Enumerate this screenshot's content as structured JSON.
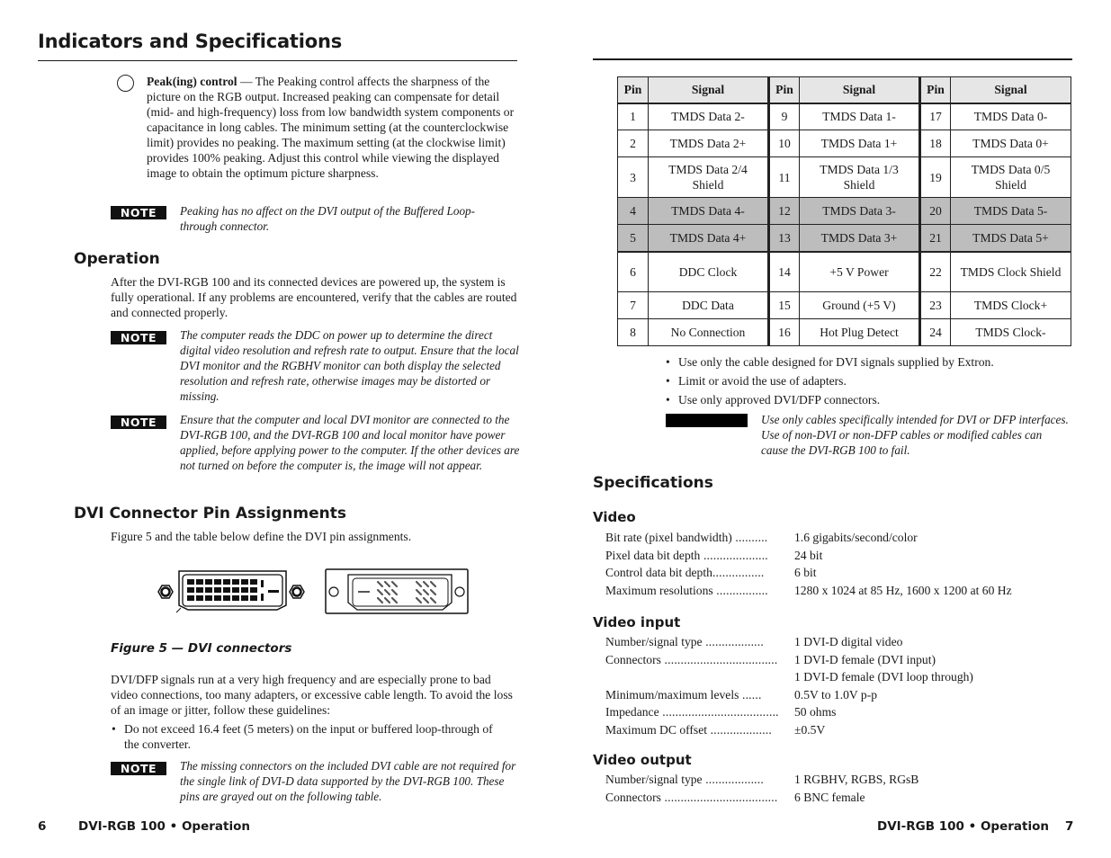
{
  "left_page": {
    "title": "Indicators and Specifications",
    "peak_control": {
      "icon": "circle-control-icon",
      "label": "Peak(ing) control",
      "text": " — The Peaking control affects the sharpness of the picture on the RGB output.  Increased peaking can compensate for detail (mid- and high-frequency) loss from low bandwidth system components or capacitance in long cables.  The minimum setting (at the counterclockwise limit) provides no peaking.  The maximum setting (at the clockwise limit) provides 100% peaking.  Adjust this control while viewing the displayed image to obtain the optimum picture sharpness."
    },
    "note_label": "NOTE",
    "note_peaking": "Peaking has no affect on the DVI output of the Buffered Loop-through connector.",
    "operation": {
      "heading": "Operation",
      "text": "After the DVI-RGB 100 and its connected devices are powered up, the system is fully operational.  If any problems are encountered, verify that the cables are routed and connected properly.",
      "note_ddc": "The computer reads the DDC on power up to determine the direct digital video resolution and refresh rate to output.  Ensure that the local DVI monitor and the RGBHV monitor can both display the selected resolution and refresh rate, otherwise images may be distorted or missing.",
      "note_power": "Ensure that the computer and local DVI monitor are connected to the DVI-RGB 100, and the DVI-RGB 100 and local monitor have power applied, before applying power to the computer.  If the other devices are not turned on before the computer is, the image will not appear."
    },
    "pin_assignments": {
      "heading": "DVI Connector Pin Assignments",
      "intro": "Figure 5 and the table below define the DVI pin assignments.",
      "figure_caption": "Figure 5 — DVI connectors",
      "figure_icons": [
        "dvi-female-connector-icon",
        "dvi-male-connector-icon"
      ],
      "guidelines_text": "DVI/DFP signals run at a very high frequency and are especially prone to bad video connections, too many adapters, or excessive cable length. To avoid the loss of an image or jitter, follow these guidelines:",
      "bullets": [
        "Do not exceed 16.4 feet (5 meters) on the input or buffered loop-through of the converter."
      ],
      "note_missing": "The missing connectors on the included DVI cable are not required for the single link of DVI-D data supported by the DVI-RGB 100.  These pins are grayed out on the following table."
    },
    "footer": {
      "page_number": "6",
      "label": "DVI-RGB 100 • Operation"
    }
  },
  "right_page": {
    "pin_table": {
      "headers": [
        "Pin",
        "Signal",
        "Pin",
        "Signal",
        "Pin",
        "Signal"
      ],
      "rows": [
        {
          "cells": [
            "1",
            "TMDS Data 2-",
            "9",
            "TMDS Data 1-",
            "17",
            "TMDS Data 0-"
          ],
          "grayed": false
        },
        {
          "cells": [
            "2",
            "TMDS Data 2+",
            "10",
            "TMDS Data 1+",
            "18",
            "TMDS Data 0+"
          ],
          "grayed": false
        },
        {
          "cells": [
            "3",
            "TMDS Data 2/4 Shield",
            "11",
            "TMDS Data 1/3 Shield",
            "19",
            "TMDS Data 0/5 Shield"
          ],
          "grayed": false
        },
        {
          "cells": [
            "4",
            "TMDS Data 4-",
            "12",
            "TMDS Data 3-",
            "20",
            "TMDS Data 5-"
          ],
          "grayed": true
        },
        {
          "cells": [
            "5",
            "TMDS Data 4+",
            "13",
            "TMDS Data 3+",
            "21",
            "TMDS Data 5+"
          ],
          "grayed": true
        },
        {
          "cells": [
            "6",
            "DDC Clock",
            "14",
            "+5 V Power",
            "22",
            "TMDS Clock Shield"
          ],
          "grayed": false
        },
        {
          "cells": [
            "7",
            "DDC Data",
            "15",
            "Ground (+5 V)",
            "23",
            "TMDS Clock+"
          ],
          "grayed": false
        },
        {
          "cells": [
            "8",
            "No Connection",
            "16",
            "Hot Plug Detect",
            "24",
            "TMDS Clock-"
          ],
          "grayed": false
        }
      ],
      "gray_color": "#bdbdbd",
      "header_color": "#e6e6e6"
    },
    "bullets": [
      "Use only the cable designed for DVI signals supplied by Extron.",
      "Limit or avoid the use of adapters.",
      "Use only approved DVI/DFP connectors."
    ],
    "cable_note": "Use only cables specifically intended for DVI or DFP interfaces.  Use of non-DVI or non-DFP cables or modified cables can cause the DVI-RGB 100 to fail.",
    "specifications": {
      "heading": "Specifications",
      "video": {
        "heading": "Video",
        "rows": [
          {
            "label": "Bit rate (pixel bandwidth)",
            "dots": " ..........",
            "value": "1.6 gigabits/second/color"
          },
          {
            "label": "Pixel data bit depth",
            "dots": " ....................",
            "value": "24 bit"
          },
          {
            "label": "Control data bit depth",
            "dots": "................",
            "value": "6 bit"
          },
          {
            "label": "Maximum resolutions",
            "dots": " ................",
            "value": "1280 x 1024 at 85 Hz,  1600 x 1200 at 60 Hz"
          }
        ]
      },
      "video_input": {
        "heading": "Video input",
        "rows": [
          {
            "label": "Number/signal type",
            "dots": " ..................",
            "value": "1 DVI-D digital video"
          },
          {
            "label": "Connectors",
            "dots": " ...................................",
            "value": "1 DVI-D female (DVI input)"
          },
          {
            "label": "",
            "dots": "",
            "value": "1 DVI-D female (DVI loop through)"
          },
          {
            "label": "Minimum/maximum levels",
            "dots": " ......",
            "value": "0.5V to 1.0V p-p"
          },
          {
            "label": "Impedance",
            "dots": " ....................................",
            "value": "50 ohms"
          },
          {
            "label": "Maximum DC offset",
            "dots": " ...................",
            "value": "±0.5V"
          }
        ]
      },
      "video_output": {
        "heading": "Video output",
        "rows": [
          {
            "label": "Number/signal type",
            "dots": " ..................",
            "value": "1 RGBHV, RGBS, RGsB"
          },
          {
            "label": "Connectors",
            "dots": " ...................................",
            "value": "6 BNC female"
          }
        ]
      }
    },
    "footer": {
      "label": "DVI-RGB 100 • Operation",
      "page_number": "7"
    }
  }
}
